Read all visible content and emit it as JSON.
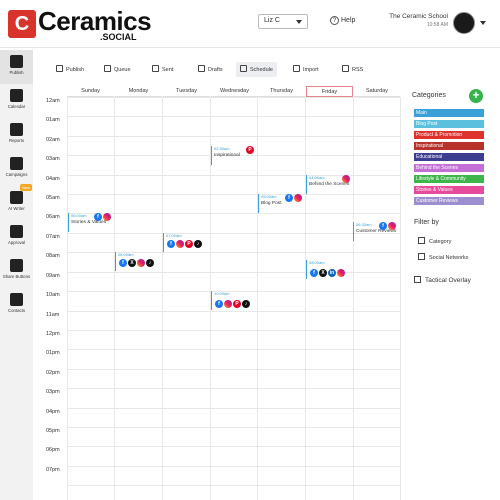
{
  "brand": {
    "mark": "C",
    "name": "Ceramics",
    "sub": ".SOCIAL"
  },
  "header": {
    "user": "Liz C",
    "help": "Help",
    "school_name": "The Ceramic School",
    "school_time": "10:58 AM"
  },
  "sidebar": {
    "items": [
      {
        "label": "Publish",
        "icon": "paper-plane-icon"
      },
      {
        "label": "Calendar",
        "icon": "calendar-icon"
      },
      {
        "label": "Reports",
        "icon": "bar-chart-icon"
      },
      {
        "label": "Campaigns",
        "icon": "trophy-icon"
      },
      {
        "label": "AI Writer",
        "icon": "ai-writer-icon",
        "badge": "New"
      },
      {
        "label": "Approval",
        "icon": "approval-icon"
      },
      {
        "label": "Share Buttons",
        "icon": "share-icon"
      },
      {
        "label": "Contacts",
        "icon": "contacts-icon"
      }
    ]
  },
  "toolbar": {
    "items": [
      {
        "label": "Publish",
        "icon": "paper-plane-icon"
      },
      {
        "label": "Queue",
        "icon": "queue-icon"
      },
      {
        "label": "Sent",
        "icon": "list-icon"
      },
      {
        "label": "Drafts",
        "icon": "draft-icon"
      },
      {
        "label": "Schedule",
        "icon": "calendar-icon"
      },
      {
        "label": "Import",
        "icon": "import-icon"
      },
      {
        "label": "RSS",
        "icon": "rss-icon"
      }
    ]
  },
  "calendar": {
    "days": [
      "Sunday",
      "Monday",
      "Tuesday",
      "Wednesday",
      "Thursday",
      "Friday",
      "Saturday"
    ],
    "today": "Friday",
    "hours": [
      "12am",
      "01am",
      "02am",
      "03am",
      "04am",
      "05am",
      "06am",
      "07am",
      "08am",
      "09am",
      "10am",
      "11am",
      "12pm",
      "01pm",
      "02pm",
      "03pm",
      "04pm",
      "05pm",
      "06pm",
      "07pm"
    ],
    "events": [
      {
        "day": "Wednesday",
        "time": "02:30am",
        "title": "Inspirational",
        "networks": [
          "pinterest"
        ]
      },
      {
        "day": "Friday",
        "time": "04:00am",
        "title": "Behind the Scenes",
        "networks": [
          "instagram"
        ]
      },
      {
        "day": "Thursday",
        "time": "05:00am",
        "title": "Blog Post",
        "networks": [
          "facebook",
          "instagram"
        ]
      },
      {
        "day": "Sunday",
        "time": "06:00am",
        "title": "Stories & Values",
        "networks": [
          "facebook",
          "instagram"
        ]
      },
      {
        "day": "Saturday",
        "time": "06:30am",
        "title": "Customer Reviews",
        "networks": [
          "facebook",
          "instagram"
        ]
      },
      {
        "day": "Tuesday",
        "time": "07:00am",
        "title": "",
        "networks": [
          "facebook",
          "instagram",
          "pinterest",
          "tiktok"
        ]
      },
      {
        "day": "Monday",
        "time": "08:00am",
        "title": "",
        "networks": [
          "facebook",
          "x",
          "instagram",
          "tiktok"
        ]
      },
      {
        "day": "Friday",
        "time": "08:00am",
        "title": "",
        "networks": [
          "facebook",
          "x",
          "linkedin",
          "instagram"
        ]
      },
      {
        "day": "Wednesday",
        "time": "10:00am",
        "title": "",
        "networks": [
          "facebook",
          "instagram",
          "pinterest",
          "tiktok"
        ]
      }
    ]
  },
  "categories": {
    "title": "Categories",
    "items": [
      {
        "label": "Main",
        "color": "#3aa0d8"
      },
      {
        "label": "Blog Post",
        "color": "#5bc0de"
      },
      {
        "label": "Product & Promotion",
        "color": "#e0322c"
      },
      {
        "label": "Inspirational",
        "color": "#b8322a"
      },
      {
        "label": "Educational",
        "color": "#3d3d8f"
      },
      {
        "label": "Behind the Scenes",
        "color": "#c36fd6"
      },
      {
        "label": "Lifestyle & Community",
        "color": "#3db54a"
      },
      {
        "label": "Stories & Values",
        "color": "#e54b9a"
      },
      {
        "label": "Customer Reviews",
        "color": "#9d8fcf"
      }
    ]
  },
  "filter": {
    "title": "Filter by",
    "options": [
      "Category",
      "Social Networks"
    ],
    "tactical": "Tactical Overlay"
  }
}
